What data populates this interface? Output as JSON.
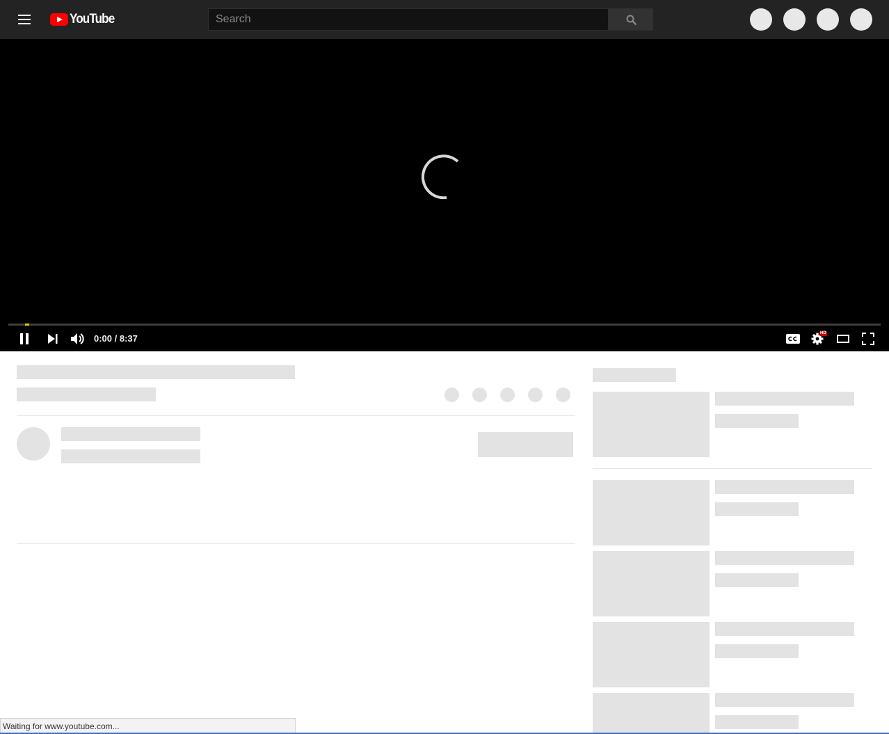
{
  "masthead": {
    "logo_text": "YouTube",
    "search": {
      "placeholder": "Search",
      "value": ""
    }
  },
  "player": {
    "time_current": "0:00",
    "time_separator": " / ",
    "time_duration": "8:37",
    "progress_fraction": 0.0,
    "state": "loading",
    "hd_badge": "HD"
  },
  "status_bar": {
    "text": "Waiting for www.youtube.com..."
  },
  "colors": {
    "masthead_bg": "#232323",
    "logo_red": "#ff0000",
    "progress_played": "#f5c400",
    "skeleton": "#e3e3e3"
  }
}
